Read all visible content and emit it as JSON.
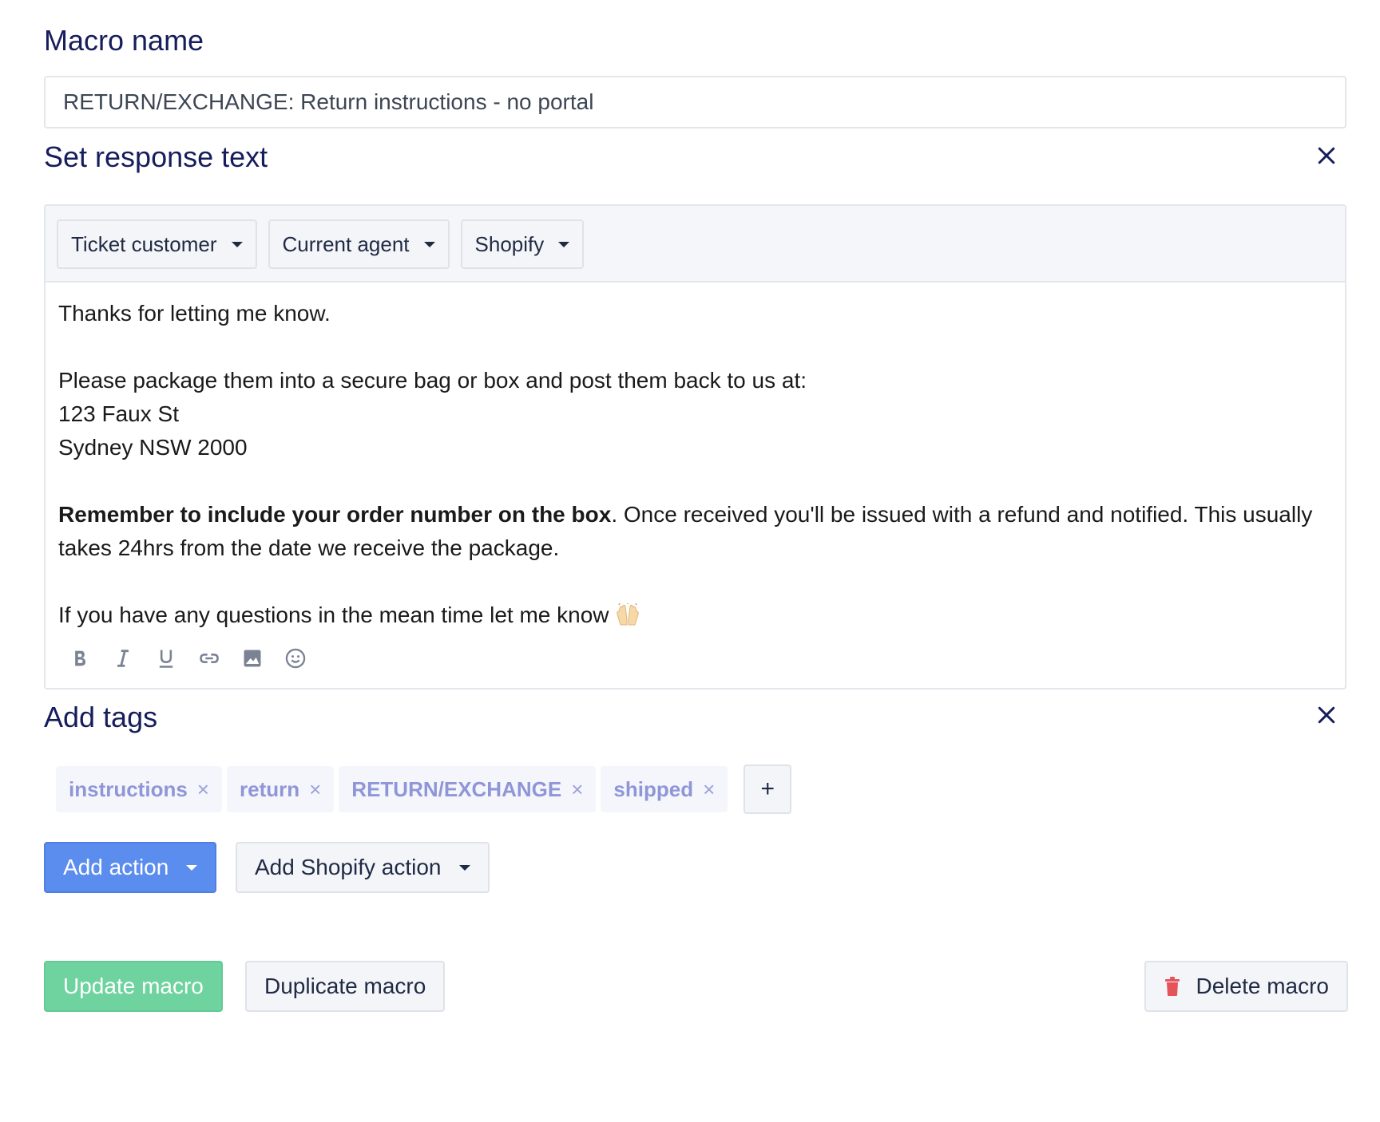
{
  "macro_name": {
    "label": "Macro name",
    "value": "RETURN/EXCHANGE: Return instructions - no portal"
  },
  "response": {
    "label": "Set response text",
    "variables": [
      {
        "label": "Ticket customer"
      },
      {
        "label": "Current agent"
      },
      {
        "label": "Shopify"
      }
    ],
    "body": {
      "line1": "Thanks for letting me know.",
      "line2": "Please package them into a secure bag or box and post them back to us at:",
      "line3": "123 Faux St",
      "line4": "Sydney NSW 2000",
      "bold": "Remember to include your order number on the box",
      "after_bold": ". Once received you'll be issued with a refund and notified. This usually takes 24hrs from the date we receive the package.",
      "closing": "If you have any questions in the mean time let me know"
    },
    "format_icons": [
      "bold-icon",
      "italic-icon",
      "underline-icon",
      "link-icon",
      "image-icon",
      "emoji-icon"
    ]
  },
  "tags": {
    "label": "Add tags",
    "items": [
      {
        "label": "instructions"
      },
      {
        "label": "return"
      },
      {
        "label": "RETURN/EXCHANGE"
      },
      {
        "label": "shipped"
      }
    ],
    "remove_glyph": "×",
    "add_glyph": "+"
  },
  "actions": {
    "add_action": "Add action",
    "add_shopify_action": "Add Shopify action"
  },
  "footer": {
    "update": "Update macro",
    "duplicate": "Duplicate macro",
    "delete": "Delete macro"
  },
  "colors": {
    "heading": "#161d5b",
    "primary": "#5b8def",
    "success": "#6fd3a0",
    "tag_text": "#8f96d8",
    "danger": "#e5535b"
  }
}
